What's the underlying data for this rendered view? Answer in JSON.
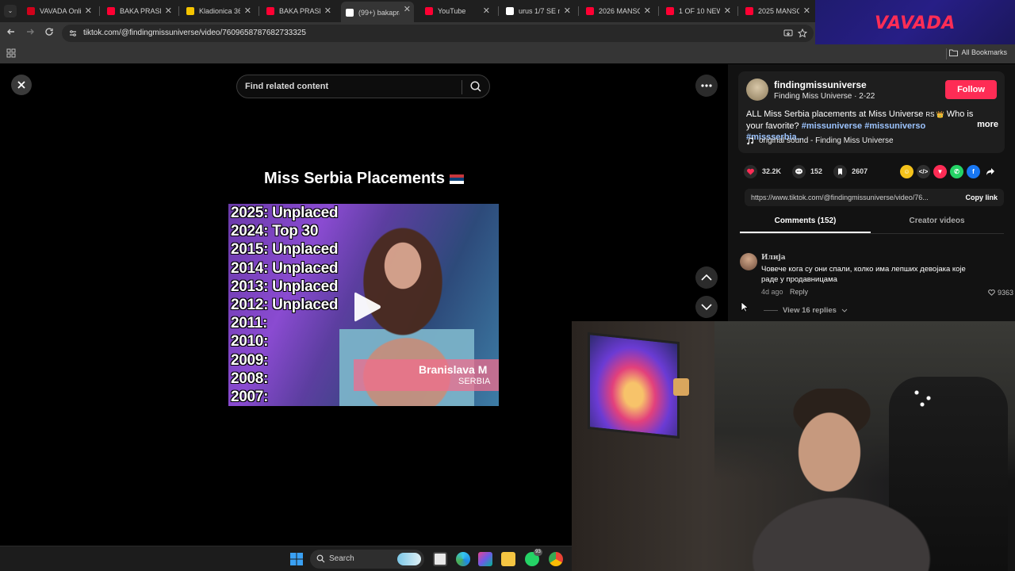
{
  "browser": {
    "tabs": [
      {
        "title": "VAVADA Online",
        "color": "#d0021b",
        "active": false
      },
      {
        "title": "BAKA PRASE X",
        "color": "#ff0033",
        "active": false
      },
      {
        "title": "Kladionica 365",
        "color": "#f5c400",
        "active": false
      },
      {
        "title": "BAKA PRASE X",
        "color": "#ff0033",
        "active": false
      },
      {
        "title": "(99+) bakapras",
        "color": "#ffffff",
        "active": true
      },
      {
        "title": "YouTube",
        "color": "#ff0033",
        "active": false
      },
      {
        "title": "urus 1/7 SE ma",
        "color": "#ffffff",
        "active": false
      },
      {
        "title": "2026 MANSOR",
        "color": "#ff0033",
        "active": false
      },
      {
        "title": "1 OF 10 NEW L",
        "color": "#ff0033",
        "active": false
      },
      {
        "title": "2025 MANSOR",
        "color": "#ff0033",
        "active": false
      }
    ],
    "url": "tiktok.com/@findingmissuniverse/video/7609658787682733325",
    "bookmarks_label": "All Bookmarks"
  },
  "ad": {
    "brand": "VAVADA"
  },
  "video": {
    "search_placeholder": "Find related content",
    "title": "Miss Serbia Placements",
    "placements": [
      "2025: Unplaced",
      "2024: Top 30",
      "2015: Unplaced",
      "2014: Unplaced",
      "2013: Unplaced",
      "2012: Unplaced",
      "2011:",
      "2010:",
      "2009:",
      "2008:",
      "2007:"
    ],
    "nameplate_name": "Branislava M",
    "nameplate_country": "SERBIA"
  },
  "post": {
    "author": "findingmissuniverse",
    "subtitle": "Finding Miss Universe · 2-22",
    "follow_label": "Follow",
    "description_text": "ALL Miss Serbia placements at Miss Universe ",
    "description_emoji": "RS 👑",
    "description_question": " Who is your favorite? ",
    "hashtags": "#missuniverse #missuniverso #missserbia...",
    "more_label": "more",
    "sound": "original sound - Finding Miss Universe",
    "likes": "32.2K",
    "comments_count": "152",
    "saves": "2607",
    "share_link": "https://www.tiktok.com/@findingmissuniverse/video/76...",
    "copy_link_label": "Copy link"
  },
  "tabs": {
    "comments": "Comments (152)",
    "creator": "Creator videos"
  },
  "comment": {
    "user": "Илија",
    "text": "Човече кога су они спали, колко има лепших девојака које раде у продавницама",
    "date": "4d ago",
    "reply_label": "Reply",
    "likes": "9363",
    "view_replies": "View 16 replies"
  },
  "taskbar": {
    "search_label": "Search",
    "badge": "93"
  }
}
